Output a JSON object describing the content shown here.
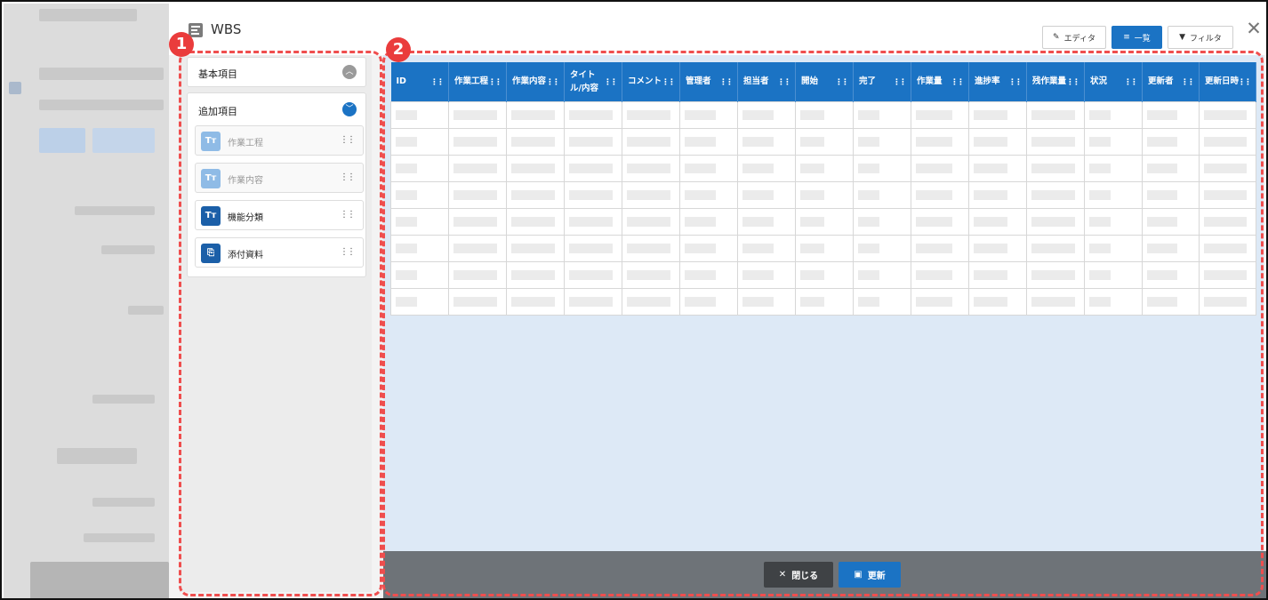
{
  "dialog": {
    "title": "WBS",
    "tabs": [
      {
        "label": "エディタ",
        "icon": "edit-icon",
        "active": false
      },
      {
        "label": "一覧",
        "icon": "list-icon",
        "active": true
      },
      {
        "label": "フィルタ",
        "icon": "filter-icon",
        "active": false
      }
    ],
    "close_icon": "close-icon"
  },
  "left_panel": {
    "basic": {
      "title": "基本項目",
      "toggle": "chevron-up-icon"
    },
    "additional": {
      "title": "追加項目",
      "toggle": "chevron-down-icon",
      "items": [
        {
          "badge": "Tт",
          "label": "作業工程",
          "enabled": false
        },
        {
          "badge": "Tт",
          "label": "作業内容",
          "enabled": false
        },
        {
          "badge": "Tт",
          "label": "機能分類",
          "enabled": true
        },
        {
          "badge": "attachment-icon",
          "label": "添付資料",
          "enabled": true
        }
      ]
    }
  },
  "grid": {
    "columns": [
      "ID",
      "作業工程",
      "作業内容",
      "タイトル/内容",
      "コメント",
      "管理者",
      "担当者",
      "開始",
      "完了",
      "作業量",
      "進捗率",
      "残作業量",
      "状況",
      "更新者",
      "更新日時"
    ],
    "row_count": 8
  },
  "footer": {
    "close_label": "閉じる",
    "update_label": "更新"
  },
  "markers": [
    "1",
    "2"
  ],
  "colors": {
    "accent": "#1b73c4",
    "marker": "#ea3c3c",
    "footer": "#6e7378"
  }
}
